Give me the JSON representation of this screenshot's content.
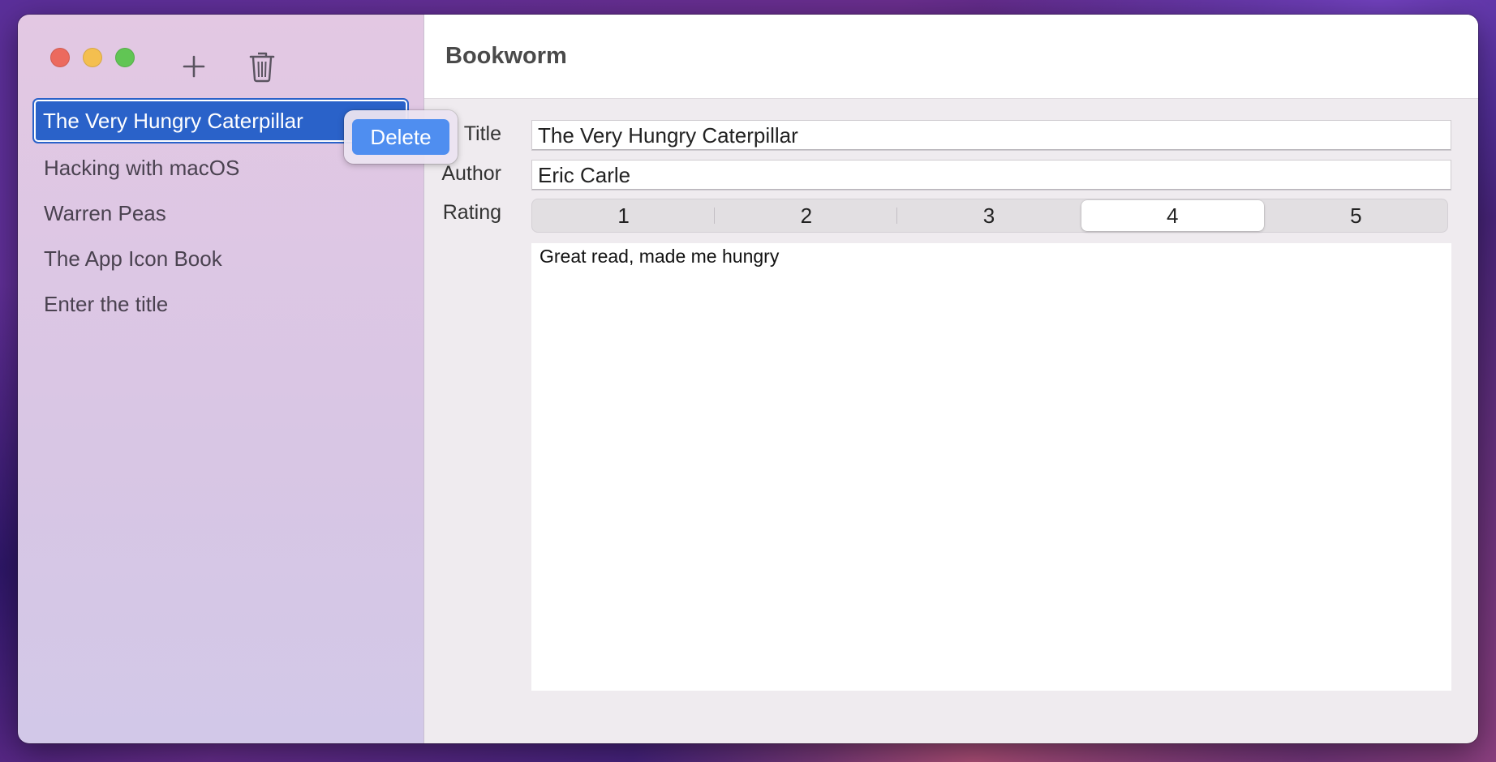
{
  "app": {
    "title": "Bookworm"
  },
  "window_controls": {
    "close_color": "#ec6a5e",
    "minimize_color": "#f4bf4f",
    "zoom_color": "#61c554"
  },
  "toolbar": {
    "add_icon": "plus-icon",
    "delete_icon": "trash-icon"
  },
  "sidebar": {
    "items": [
      {
        "label": "The Very Hungry Caterpillar",
        "selected": true
      },
      {
        "label": "Hacking with macOS",
        "selected": false
      },
      {
        "label": "Warren Peas",
        "selected": false
      },
      {
        "label": "The App Icon Book",
        "selected": false
      },
      {
        "label": "Enter the title",
        "selected": false
      }
    ],
    "selection_color": "#2a62c9"
  },
  "popover": {
    "delete_label": "Delete",
    "button_color": "#4f8ef0"
  },
  "form": {
    "title_label": "Title",
    "title_value": "The Very Hungry Caterpillar",
    "author_label": "Author",
    "author_value": "Eric Carle",
    "rating_label": "Rating",
    "rating_options": [
      "1",
      "2",
      "3",
      "4",
      "5"
    ],
    "rating_selected": "4",
    "notes_value": "Great read, made me hungry"
  }
}
